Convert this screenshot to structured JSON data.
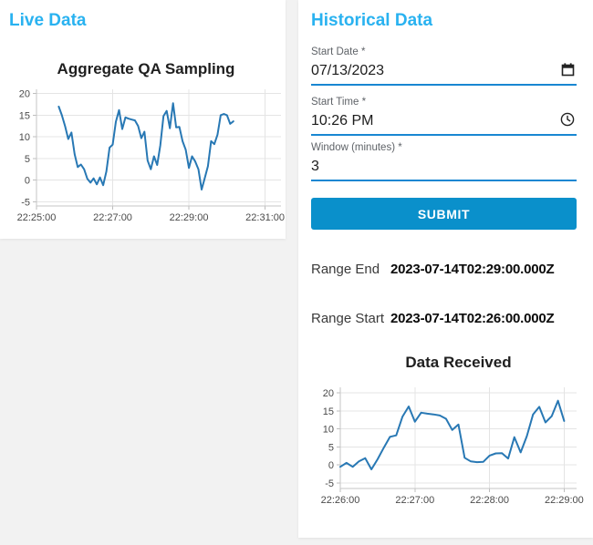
{
  "theme": {
    "background": "#f2f2f2",
    "card": "#ffffff",
    "section_title_color": "#29b2f0",
    "primary_button_color": "#0a90cb",
    "field_underline_color": "#1887d2",
    "chart_line_color": "#2878b4",
    "grid_color": "#e4e4e4"
  },
  "live_panel": {
    "title": "Live Data"
  },
  "historical_panel": {
    "title": "Historical Data",
    "form": {
      "start_date": {
        "label": "Start Date *",
        "value": "07/13/2023",
        "icon": "calendar-icon"
      },
      "start_time": {
        "label": "Start Time *",
        "value": "10:26 PM",
        "icon": "clock-icon"
      },
      "window": {
        "label": "Window (minutes) *",
        "value": "3"
      },
      "submit_label": "SUBMIT"
    },
    "range_end": {
      "label": "Range End",
      "value": "2023-07-14T02:29:00.000Z"
    },
    "range_start": {
      "label": "Range Start",
      "value": "2023-07-14T02:26:00.000Z"
    }
  },
  "chart_data": [
    {
      "id": "aggregate-qa-sampling",
      "type": "line",
      "title": "Aggregate QA Sampling",
      "xlabel": "",
      "ylabel": "",
      "x_base_time": "22:25:00",
      "x_tick_labels": [
        "22:25:00",
        "22:27:00",
        "22:29:00",
        "22:31:00"
      ],
      "x_tick_seconds": [
        0,
        120,
        240,
        360
      ],
      "xlim": [
        0,
        385
      ],
      "y_ticks": [
        -5,
        0,
        5,
        10,
        15,
        20
      ],
      "ylim": [
        -6,
        21
      ],
      "grid": true,
      "legend": false,
      "line_color": "#2878b4",
      "points_t": [
        35,
        40,
        45,
        50,
        55,
        60,
        65,
        70,
        75,
        80,
        85,
        90,
        95,
        100,
        105,
        110,
        115,
        120,
        125,
        130,
        135,
        140,
        145,
        150,
        155,
        160,
        165,
        170,
        175,
        180,
        185,
        190,
        195,
        200,
        205,
        210,
        215,
        220,
        225,
        230,
        235,
        240,
        245,
        250,
        255,
        260,
        265,
        270,
        275,
        280,
        285,
        290,
        295,
        300,
        305,
        310
      ],
      "points_v": [
        17.0,
        15.0,
        12.5,
        9.5,
        11.0,
        6.0,
        3.0,
        3.6,
        2.5,
        0.3,
        -0.6,
        0.4,
        -1.0,
        0.6,
        -1.2,
        2.0,
        7.5,
        8.2,
        13.5,
        16.2,
        11.8,
        14.5,
        14.2,
        14.0,
        13.8,
        12.5,
        9.7,
        11.2,
        4.5,
        2.5,
        5.5,
        3.5,
        8.0,
        14.8,
        16.0,
        12.0,
        17.8,
        12.2,
        12.3,
        9.0,
        7.0,
        2.8,
        5.5,
        4.3,
        2.5,
        -2.2,
        0.5,
        3.2,
        9.0,
        8.3,
        10.5,
        15.0,
        15.3,
        15.0,
        13.0,
        13.6
      ]
    },
    {
      "id": "data-received",
      "type": "line",
      "title": "Data Received",
      "xlabel": "",
      "ylabel": "",
      "x_base_time": "22:26:00",
      "x_tick_labels": [
        "22:26:00",
        "22:27:00",
        "22:28:00",
        "22:29:00"
      ],
      "x_tick_seconds": [
        0,
        60,
        120,
        180
      ],
      "xlim": [
        0,
        190
      ],
      "y_ticks": [
        -5,
        0,
        5,
        10,
        15,
        20
      ],
      "ylim": [
        -6.5,
        21.5
      ],
      "grid": true,
      "legend": false,
      "line_color": "#2878b4",
      "points_t": [
        0,
        5,
        10,
        15,
        20,
        25,
        30,
        35,
        40,
        45,
        50,
        55,
        60,
        65,
        70,
        75,
        80,
        85,
        90,
        95,
        100,
        105,
        110,
        115,
        120,
        125,
        130,
        135,
        140,
        145,
        150,
        155,
        160,
        165,
        170,
        175,
        180
      ],
      "points_v": [
        -0.5,
        0.6,
        -0.5,
        1.0,
        1.9,
        -1.2,
        1.6,
        4.8,
        7.8,
        8.2,
        13.4,
        16.2,
        12.0,
        14.5,
        14.2,
        14.0,
        13.7,
        12.8,
        9.7,
        11.2,
        2.0,
        1.0,
        0.8,
        0.9,
        2.6,
        3.2,
        3.3,
        1.8,
        7.7,
        3.5,
        8.0,
        14.0,
        16.1,
        11.8,
        13.5,
        17.8,
        12.2
      ]
    }
  ]
}
